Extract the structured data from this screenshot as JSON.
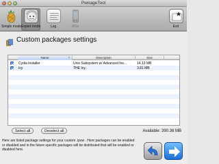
{
  "window": {
    "title": "PwnageTool"
  },
  "toolbar": {
    "items": [
      {
        "label": "Simple mode",
        "icon": "pineapple-icon"
      },
      {
        "label": "Expert mode",
        "icon": "einstein-icon"
      },
      {
        "label": "Log",
        "icon": "log-icon"
      },
      {
        "label": "IBSs",
        "icon": "iphone-icon"
      },
      {
        "label": "Exit",
        "icon": "exit-icon"
      }
    ]
  },
  "main": {
    "title": "Custom packages settings",
    "columns": [
      "Name",
      "Description",
      "Size"
    ],
    "rows": [
      {
        "checked": true,
        "name": "Cydia Installer",
        "description": "Unix Subsystem w/ Advanced Ins...",
        "size": "14.13 MB"
      },
      {
        "checked": true,
        "name": "Icy",
        "description": "THE Icy.",
        "size": "3.81 MB"
      }
    ],
    "select_all_label": "Select all",
    "deselect_all_label": "Deselect all",
    "available": "Available: 390.36 MB",
    "info_text": "Here are listed package settings for your custom .ipsw . Here packages can be enabled or disabled and in the future specific packages will be distributed that will be enabled or disabled here."
  },
  "colors": {
    "accent": "#2e63c9",
    "row_alt": "#edf3fe",
    "forward": "#1b6fd8"
  }
}
